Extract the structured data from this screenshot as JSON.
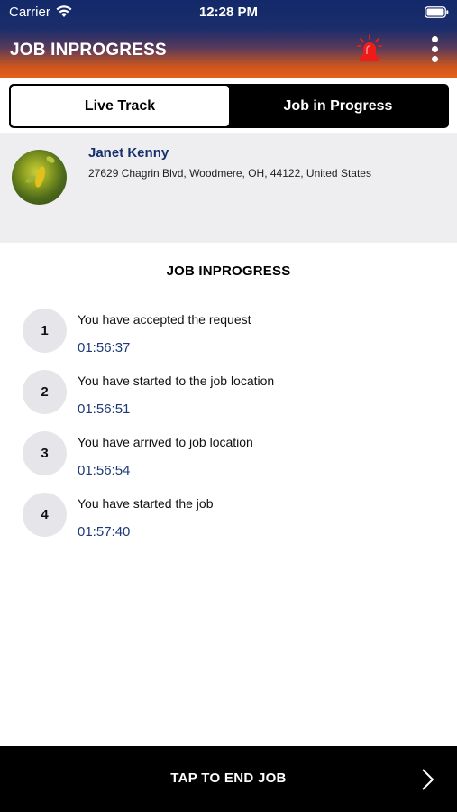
{
  "status_bar": {
    "carrier": "Carrier",
    "time": "12:28 PM"
  },
  "header": {
    "title": "JOB INPROGRESS",
    "alarm_icon": "alarm-siren-icon",
    "menu_icon": "more-vertical-icon"
  },
  "tabs": [
    {
      "label": "Live Track",
      "active": true
    },
    {
      "label": "Job in Progress",
      "active": false
    }
  ],
  "customer": {
    "name": "Janet Kenny",
    "address": "27629 Chagrin Blvd, Woodmere, OH, 44122, United States"
  },
  "progress": {
    "title": "JOB INPROGRESS",
    "steps": [
      {
        "number": "1",
        "text": "You have accepted the request",
        "time": "01:56:37"
      },
      {
        "number": "2",
        "text": "You have started to the job location",
        "time": "01:56:51"
      },
      {
        "number": "3",
        "text": "You have arrived to job location",
        "time": "01:56:54"
      },
      {
        "number": "4",
        "text": "You have started the job",
        "time": "01:57:40"
      }
    ]
  },
  "footer": {
    "end_label": "TAP TO END JOB"
  },
  "colors": {
    "accent_orange": "#e8601a",
    "navy": "#13296a",
    "alarm_red": "#ee1b1b",
    "time_blue": "#1d3a78"
  }
}
